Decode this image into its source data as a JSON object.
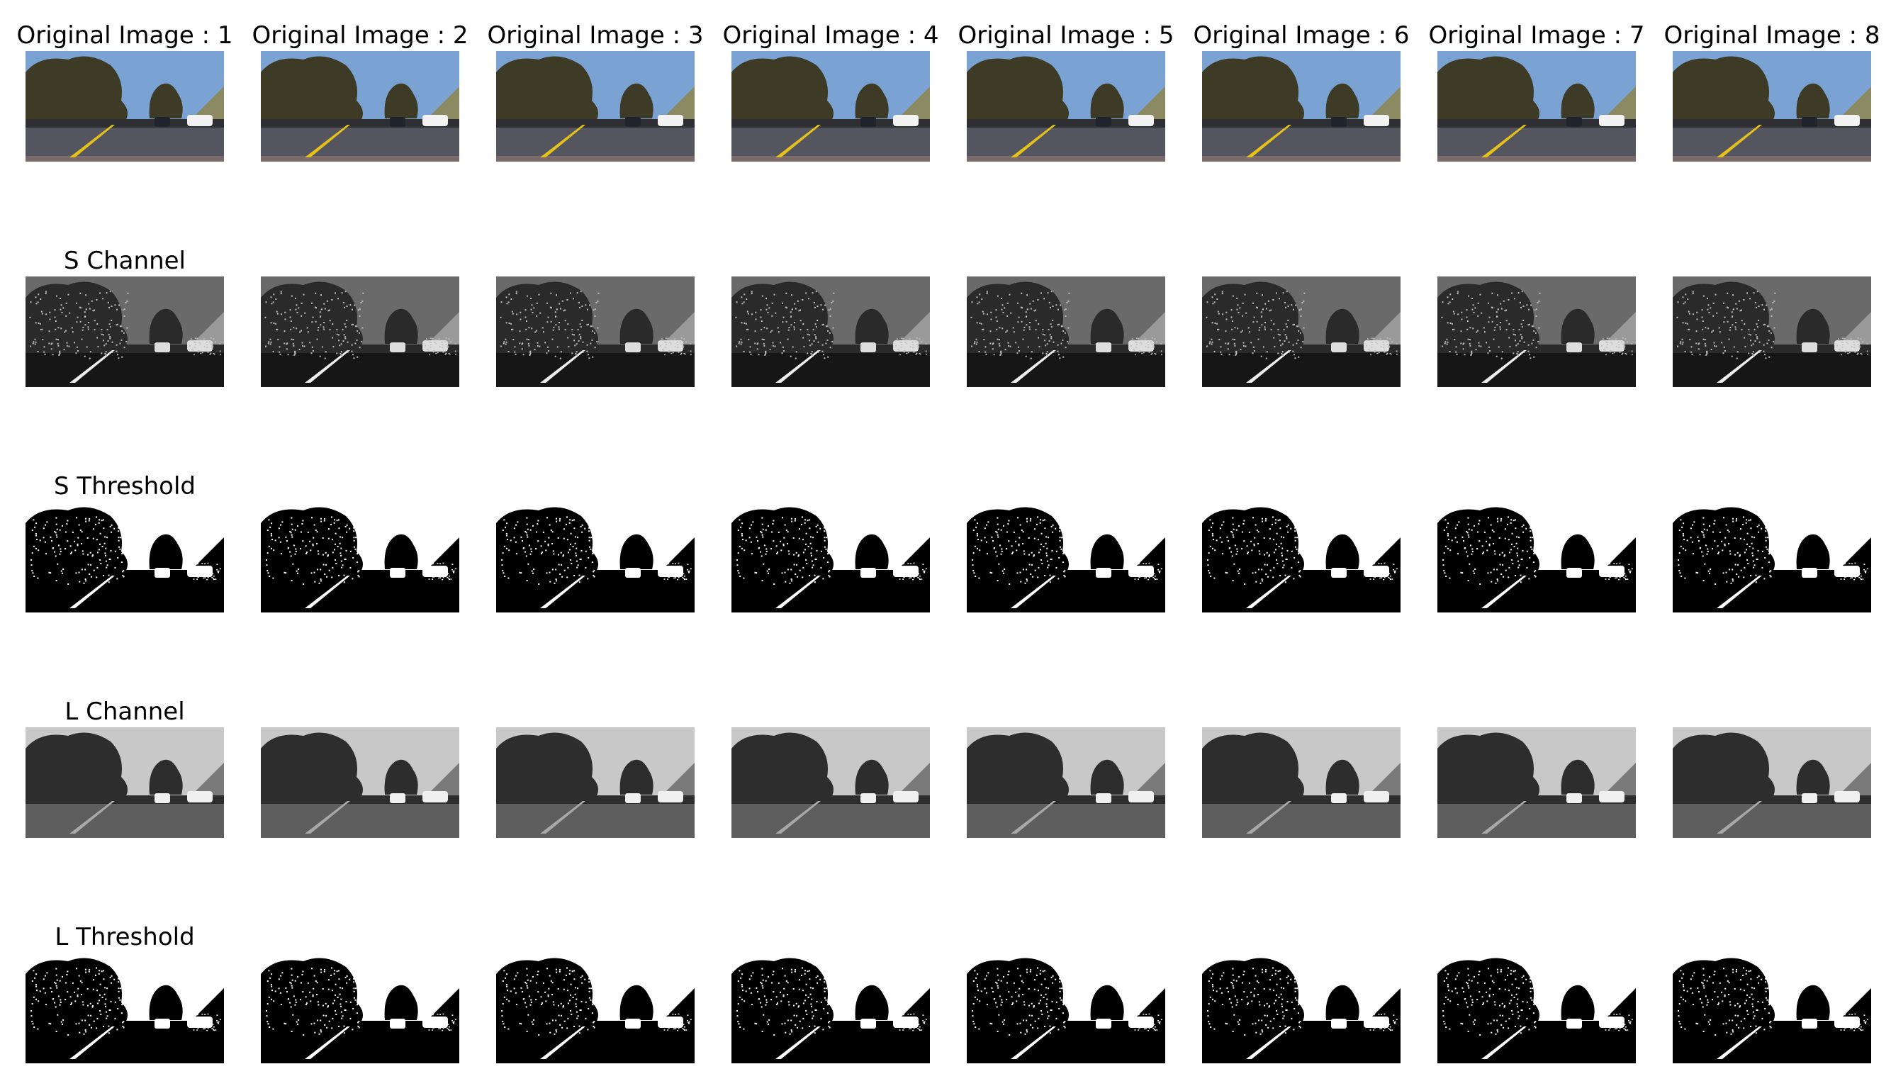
{
  "rows": [
    {
      "kind": "color",
      "titles": [
        "Original Image : 1",
        "Original Image : 2",
        "Original Image : 3",
        "Original Image : 4",
        "Original Image : 5",
        "Original Image : 6",
        "Original Image : 7",
        "Original Image : 8"
      ]
    },
    {
      "kind": "schan",
      "titles": [
        "S Channel",
        "",
        "",
        "",
        "",
        "",
        "",
        ""
      ]
    },
    {
      "kind": "sthr",
      "titles": [
        "S Threshold",
        "",
        "",
        "",
        "",
        "",
        "",
        ""
      ]
    },
    {
      "kind": "lchan",
      "titles": [
        "L Channel",
        "",
        "",
        "",
        "",
        "",
        "",
        ""
      ]
    },
    {
      "kind": "lthr",
      "titles": [
        "L Threshold",
        "",
        "",
        "",
        "",
        "",
        "",
        ""
      ]
    }
  ],
  "colors": {
    "sky": "#7aa2d2",
    "road": "#55555f",
    "lane_yellow": "#e4c21a",
    "tree": "#3d3a26",
    "grass": "#8b8a62"
  }
}
